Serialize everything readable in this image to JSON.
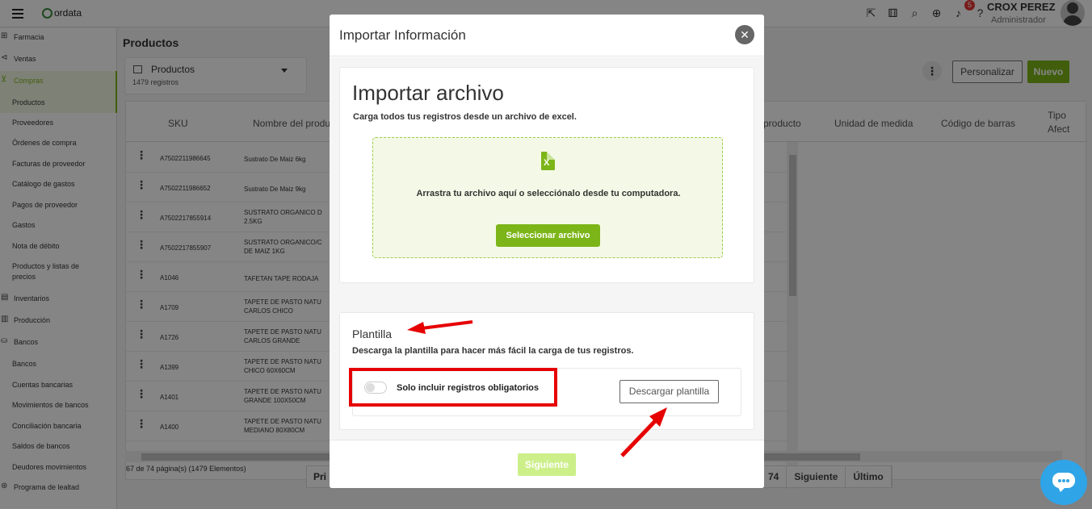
{
  "topbar": {
    "logo": "ordata",
    "badge": "5",
    "user_name": "CROX PEREZ",
    "user_role": "Administrador"
  },
  "sidebar": {
    "items": [
      {
        "label": "Farmacia",
        "icon": "pharmacy-icon"
      },
      {
        "label": "Ventas",
        "icon": "sales-icon"
      },
      {
        "label": "Compras",
        "icon": "cart-icon"
      },
      {
        "label": "Productos"
      },
      {
        "label": "Proveedores"
      },
      {
        "label": "Órdenes de compra"
      },
      {
        "label": "Facturas de proveedor"
      },
      {
        "label": "Catálogo de gastos"
      },
      {
        "label": "Pagos de proveedor"
      },
      {
        "label": "Gastos"
      },
      {
        "label": "Nota de débito"
      },
      {
        "label": "Productos y listas de precios"
      },
      {
        "label": "Inventarios",
        "icon": "inventory-icon"
      },
      {
        "label": "Producción",
        "icon": "production-icon"
      },
      {
        "label": "Bancos",
        "icon": "bank-icon"
      },
      {
        "label": "Bancos"
      },
      {
        "label": "Cuentas bancarias"
      },
      {
        "label": "Movimientos de bancos"
      },
      {
        "label": "Conciliación bancaria"
      },
      {
        "label": "Saldos de bancos"
      },
      {
        "label": "Deudores movimientos"
      },
      {
        "label": "Programa de lealtad",
        "icon": "loyalty-icon"
      }
    ]
  },
  "main": {
    "title": "Productos",
    "selector": {
      "label": "Productos",
      "count": "1479 registros"
    },
    "buttons": {
      "personalizar": "Personalizar",
      "nuevo": "Nuevo"
    },
    "columns": [
      "SKU",
      "Nombre del producto",
      "producto",
      "Unidad de medida",
      "Código de barras",
      "Tipo",
      "Afect"
    ],
    "rows": [
      {
        "sku": "A7502211986645",
        "name": "Sustrato De Maiz 6kg"
      },
      {
        "sku": "A7502211986652",
        "name": "Sustrato De Maiz 9kg"
      },
      {
        "sku": "A7502217855914",
        "name": "SUSTRATO ORGANICO D 2.5KG"
      },
      {
        "sku": "A7502217855907",
        "name": "SUSTRATO ORGANICO/C DE MAIZ 1KG"
      },
      {
        "sku": "A1046",
        "name": "TAFETAN TAPE RODAJA"
      },
      {
        "sku": "A1709",
        "name": "TAPETE DE PASTO NATU CARLOS CHICO"
      },
      {
        "sku": "A1726",
        "name": "TAPETE DE PASTO NATU CARLOS GRANDE"
      },
      {
        "sku": "A1399",
        "name": "TAPETE DE PASTO NATU CHICO 60X60CM"
      },
      {
        "sku": "A1401",
        "name": "TAPETE DE PASTO NATU GRANDE 100X50CM"
      },
      {
        "sku": "A1400",
        "name": "TAPETE DE PASTO NATU MEDIANO 80X80CM"
      }
    ],
    "pager_info": "67 de 74 página(s) (1479 Elementos)",
    "pager_left": [
      "Pri"
    ],
    "pager_right": [
      "74",
      "Siguiente",
      "Último"
    ]
  },
  "modal": {
    "title": "Importar Información",
    "import": {
      "title": "Importar archivo",
      "subtitle": "Carga todos tus registros desde un archivo de excel.",
      "drop_text": "Arrastra tu archivo aquí o selecciónalo desde tu computadora.",
      "select_button": "Seleccionar archivo",
      "file_icon_letter": "X"
    },
    "template": {
      "title": "Plantilla",
      "subtitle": "Descarga la plantilla para hacer más fácil la carga de tus registros.",
      "toggle_label": "Solo incluir registros obligatorios",
      "toggle_on": false,
      "download_button": "Descargar plantilla"
    },
    "next_button": "Siguiente"
  },
  "colors": {
    "accent": "#7cb518",
    "annotation": "#e60000",
    "chat": "#2fa4e7"
  }
}
